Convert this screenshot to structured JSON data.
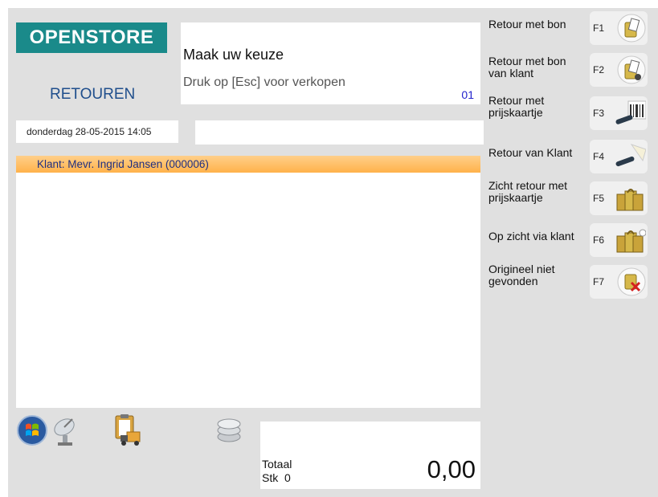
{
  "brand": {
    "logo_text": "OPENSTORE",
    "mode_label": "RETOUREN"
  },
  "prompt": {
    "title": "Maak uw keuze",
    "subtitle": "Druk op [Esc] voor verkopen",
    "register": "01"
  },
  "status": {
    "datetime": "donderdag 28-05-2015 14:05",
    "input_value": ""
  },
  "list": {
    "customer_line": "Klant: Mevr. Ingrid Jansen (000006)"
  },
  "totals": {
    "label": "Totaal",
    "count_label": "Stk",
    "count": "0",
    "amount": "0,00"
  },
  "function_keys": [
    {
      "label": "Retour met bon",
      "key": "F1",
      "icon": "bags-receipt-icon"
    },
    {
      "label": "Retour met bon van klant",
      "key": "F2",
      "icon": "bags-receipt-customer-icon"
    },
    {
      "label": "Retour met prijskaartje",
      "key": "F3",
      "icon": "barcode-scanner-icon"
    },
    {
      "label": "Retour van Klant",
      "key": "F4",
      "icon": "scanner-customer-icon"
    },
    {
      "label": "Zicht retour met prijskaartje",
      "key": "F5",
      "icon": "shopping-bags-icon"
    },
    {
      "label": "Op zicht via klant",
      "key": "F6",
      "icon": "shopping-bags-customer-icon"
    },
    {
      "label": "Origineel niet gevonden",
      "key": "F7",
      "icon": "bag-not-found-icon"
    }
  ],
  "taskbar": [
    {
      "icon": "windows-start-icon"
    },
    {
      "icon": "satellite-dish-icon"
    },
    {
      "icon": "clipboard-delivery-icon"
    },
    {
      "icon": "coins-stack-icon"
    }
  ]
}
